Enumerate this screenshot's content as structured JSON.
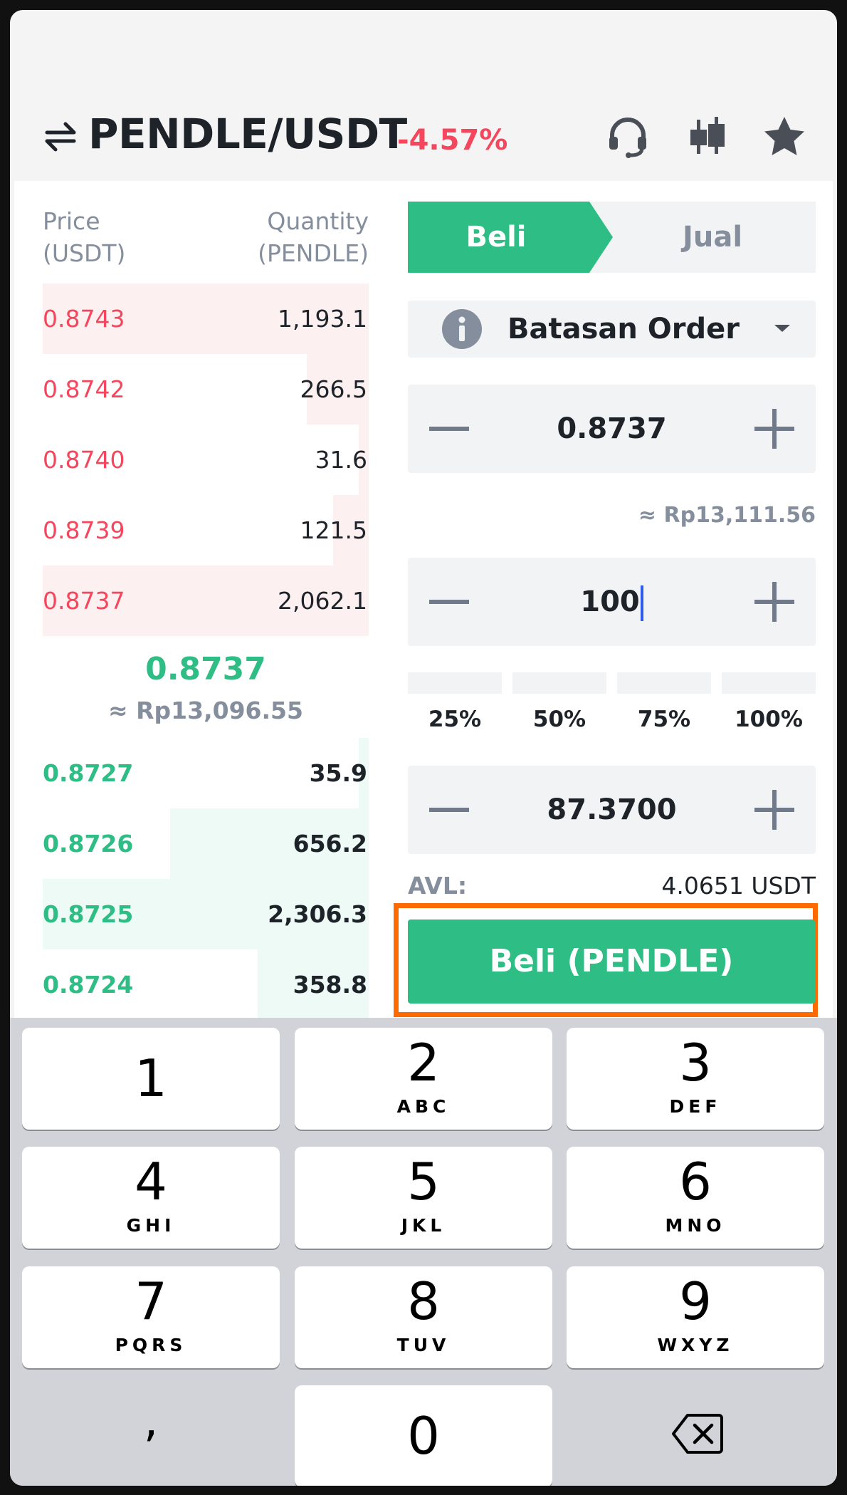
{
  "header": {
    "pair": "PENDLE/USDT",
    "change": "-4.57%",
    "icons": [
      "swap-icon",
      "headset-icon",
      "candlestick-icon",
      "star-icon"
    ]
  },
  "orderbook": {
    "price_header": [
      "Price",
      "(USDT)"
    ],
    "qty_header": [
      "Quantity",
      "(PENDLE)"
    ],
    "asks": [
      {
        "price": "0.8743",
        "qty": "1,193.1",
        "depth": 1.0
      },
      {
        "price": "0.8742",
        "qty": "266.5",
        "depth": 0.19
      },
      {
        "price": "0.8740",
        "qty": "31.6",
        "depth": 0.03
      },
      {
        "price": "0.8739",
        "qty": "121.5",
        "depth": 0.11
      },
      {
        "price": "0.8737",
        "qty": "2,062.1",
        "depth": 1.0
      }
    ],
    "last_price": "0.8737",
    "last_price_fiat": "≈ Rp13,096.55",
    "bids": [
      {
        "price": "0.8727",
        "qty": "35.9",
        "depth": 0.03
      },
      {
        "price": "0.8726",
        "qty": "656.2",
        "depth": 0.61
      },
      {
        "price": "0.8725",
        "qty": "2,306.3",
        "depth": 1.0
      },
      {
        "price": "0.8724",
        "qty": "358.8",
        "depth": 0.34
      }
    ]
  },
  "form": {
    "tab_buy": "Beli",
    "tab_sell": "Jual",
    "order_type": "Batasan Order",
    "price_value": "0.8737",
    "price_fiat": "≈ Rp13,111.56",
    "amount_value": "100",
    "percent_options": [
      "25%",
      "50%",
      "75%",
      "100%"
    ],
    "total_value": "87.3700",
    "avl_label": "AVL:",
    "avl_value": "4.0651 USDT",
    "submit_label": "Beli (PENDLE)"
  },
  "keyboard": {
    "keys": [
      {
        "digit": "1",
        "letters": ""
      },
      {
        "digit": "2",
        "letters": "ABC"
      },
      {
        "digit": "3",
        "letters": "DEF"
      },
      {
        "digit": "4",
        "letters": "GHI"
      },
      {
        "digit": "5",
        "letters": "JKL"
      },
      {
        "digit": "6",
        "letters": "MNO"
      },
      {
        "digit": "7",
        "letters": "PQRS"
      },
      {
        "digit": "8",
        "letters": "TUV"
      },
      {
        "digit": "9",
        "letters": "WXYZ"
      },
      {
        "digit": "0",
        "letters": ""
      }
    ],
    "comma": ","
  },
  "colors": {
    "buy_green": "#2ebd85",
    "sell_red": "#f6465d",
    "highlight_orange": "#ff6a00"
  }
}
